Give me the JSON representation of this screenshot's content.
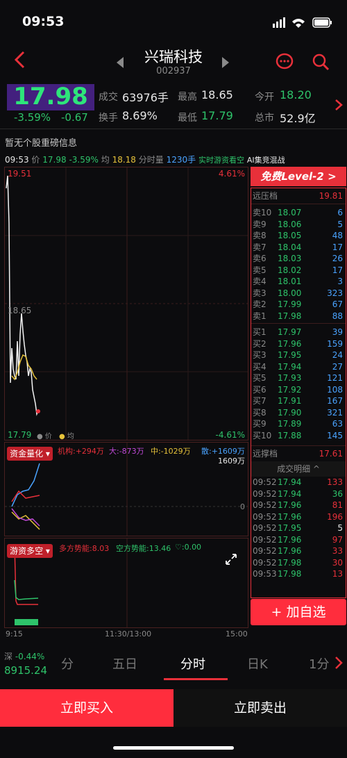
{
  "status": {
    "time": "09:53"
  },
  "header": {
    "title": "兴瑞科技",
    "code": "002937"
  },
  "quote": {
    "price": "17.98",
    "change_pct": "-3.59%",
    "change": "-0.67",
    "items": [
      {
        "label": "成交",
        "value": "63976手"
      },
      {
        "label": "最高",
        "value": "18.65"
      },
      {
        "label": "今开",
        "value": "18.20"
      },
      {
        "label": "换手",
        "value": "8.69%"
      },
      {
        "label": "最低",
        "value": "17.79"
      },
      {
        "label": "总市",
        "value": "52.9亿"
      }
    ]
  },
  "notice": "暂无个股重磅信息",
  "infobar": {
    "time": "09:53",
    "price_label": "价",
    "price": "17.98",
    "pct": "-3.59%",
    "avg_label": "均",
    "avg": "18.18",
    "vol_label": "分时量",
    "vol": "1230手",
    "link1": "实时游资看空",
    "link2": "AI集竞混战"
  },
  "chart": {
    "top": "19.51",
    "top_pct": "4.61%",
    "mid": "18.65",
    "bottom": "17.79",
    "bottom_pct": "-4.61%",
    "legend_price": "价",
    "legend_avg": "均"
  },
  "fund": {
    "btn": "资金量化",
    "jg": "机构:+294万",
    "da": "大:-873万",
    "zhong": "中:-1029万",
    "san": "散:+1609万",
    "right_val": "1609万",
    "zero": "0"
  },
  "youzi": {
    "btn": "游资多空",
    "duo": "多方势能:8.03",
    "kong": "空方势能:13.46",
    "heart": "♡:0.00"
  },
  "xaxis": {
    "start": "9:15",
    "mid": "11:30/13:00",
    "end": "15:00"
  },
  "level2": {
    "btn": "免费Level-2 >",
    "far_sell_label": "远压档",
    "far_sell": "19.81",
    "far_buy_label": "远撑档",
    "far_buy": "17.61",
    "sells": [
      [
        "卖10",
        "18.07",
        "6"
      ],
      [
        "卖9",
        "18.06",
        "5"
      ],
      [
        "卖8",
        "18.05",
        "48"
      ],
      [
        "卖7",
        "18.04",
        "17"
      ],
      [
        "卖6",
        "18.03",
        "26"
      ],
      [
        "卖5",
        "18.02",
        "17"
      ],
      [
        "卖4",
        "18.01",
        "3"
      ],
      [
        "卖3",
        "18.00",
        "323"
      ],
      [
        "卖2",
        "17.99",
        "67"
      ],
      [
        "卖1",
        "17.98",
        "88"
      ]
    ],
    "buys": [
      [
        "买1",
        "17.97",
        "39"
      ],
      [
        "买2",
        "17.96",
        "159"
      ],
      [
        "买3",
        "17.95",
        "24"
      ],
      [
        "买4",
        "17.94",
        "27"
      ],
      [
        "买5",
        "17.93",
        "121"
      ],
      [
        "买6",
        "17.92",
        "108"
      ],
      [
        "买7",
        "17.91",
        "167"
      ],
      [
        "买8",
        "17.90",
        "321"
      ],
      [
        "买9",
        "17.89",
        "63"
      ],
      [
        "买10",
        "17.88",
        "145"
      ]
    ]
  },
  "trades": {
    "title": "成交明细 ^",
    "rows": [
      [
        "09:52",
        "17.94",
        "133"
      ],
      [
        "09:52",
        "17.94",
        "36"
      ],
      [
        "09:52",
        "17.96",
        "81"
      ],
      [
        "09:52",
        "17.96",
        "196"
      ],
      [
        "09:52",
        "17.95",
        "5"
      ],
      [
        "09:52",
        "17.96",
        "97"
      ],
      [
        "09:52",
        "17.96",
        "33"
      ],
      [
        "09:52",
        "17.98",
        "30"
      ],
      [
        "09:53",
        "17.98",
        "13"
      ]
    ]
  },
  "add_btn": "+ 加自选",
  "index": {
    "name": "深",
    "pct": "-0.44%",
    "value": "8915.24"
  },
  "tabs": [
    "分",
    "五日",
    "分时",
    "日K",
    "1分"
  ],
  "actions": {
    "buy": "立即买入",
    "sell": "立即卖出"
  },
  "colors": {
    "up": "#e8303a",
    "down": "#2ec36a",
    "accent": "#ff2d3d",
    "price_bg": "#43207e"
  }
}
